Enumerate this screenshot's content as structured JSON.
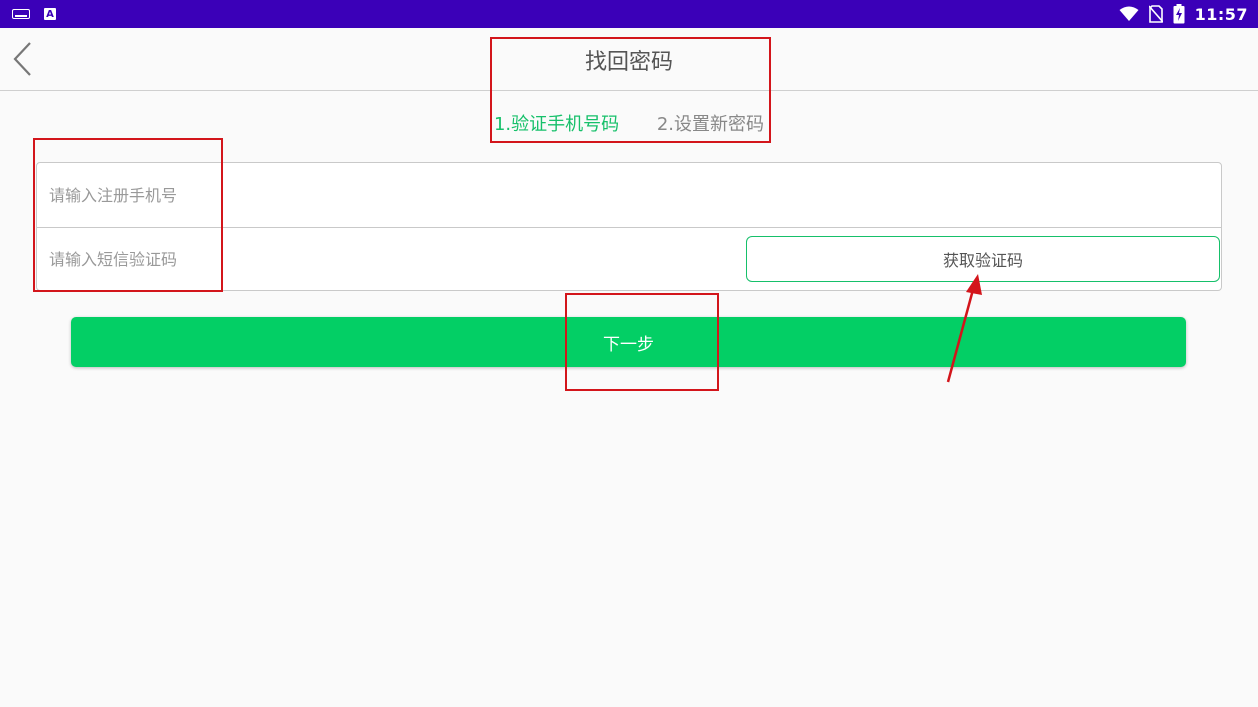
{
  "status_bar": {
    "left_icons": [
      "keyboard-icon",
      "app-a-icon"
    ],
    "right_icons": [
      "wifi-icon",
      "no-sim-icon",
      "battery-charging-icon"
    ],
    "time": "11:57",
    "app_icon_letter": "A"
  },
  "header": {
    "title": "找回密码",
    "back_icon": "chevron-left-icon"
  },
  "steps": [
    {
      "label": "1.验证手机号码",
      "active": true
    },
    {
      "label": "2.设置新密码",
      "active": false
    }
  ],
  "form": {
    "phone_placeholder": "请输入注册手机号",
    "phone_value": "",
    "code_placeholder": "请输入短信验证码",
    "code_value": "",
    "get_code_label": "获取验证码"
  },
  "next_label": "下一步",
  "colors": {
    "status_bar": "#3b00b8",
    "accent_green": "#03cf65",
    "step_active": "#16c06a",
    "annotation_red": "#d3151b"
  }
}
